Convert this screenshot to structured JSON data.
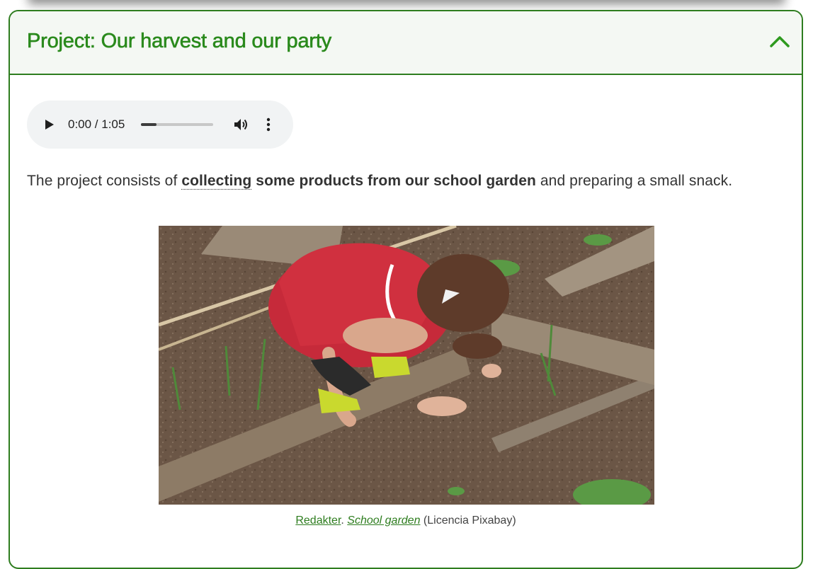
{
  "panel": {
    "title": "Project: Our harvest and our party",
    "collapse_icon": "chevron-up-icon",
    "accent_color": "#2e7d1f",
    "header_bg": "#f4f8f3"
  },
  "audio": {
    "play_icon": "play-icon",
    "time": "0:00 / 1:05",
    "progress": 0.22,
    "volume_icon": "volume-icon",
    "more_icon": "more-vertical-icon"
  },
  "description": {
    "before": "The project consists of ",
    "term": "collecting",
    "bold_rest": " some products from our school garden",
    "after": " and preparing a small snack."
  },
  "figure": {
    "image_alt": "Child in red shirt and brown cap crouching over soil in a school garden",
    "caption_author": "Redakter",
    "caption_sep": ". ",
    "caption_title": "School garden",
    "caption_license": " (Licencia Pixabay)"
  }
}
